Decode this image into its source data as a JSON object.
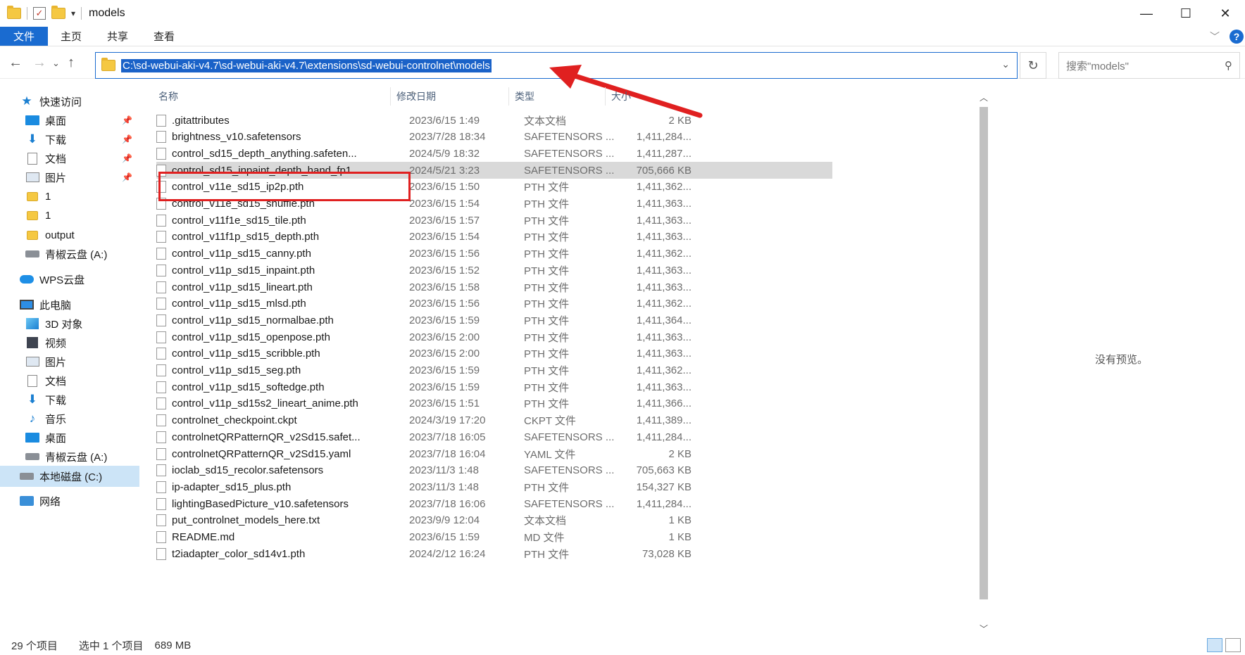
{
  "window": {
    "title": "models",
    "minimize": "—",
    "maximize": "☐",
    "close": "✕"
  },
  "ribbon": {
    "tabs": [
      "文件",
      "主页",
      "共享",
      "查看"
    ]
  },
  "address": {
    "path": "C:\\sd-webui-aki-v4.7\\sd-webui-aki-v4.7\\extensions\\sd-webui-controlnet\\models",
    "search_placeholder": "搜索\"models\""
  },
  "sidebar": {
    "items": [
      {
        "label": "快速访问",
        "icon": "star-icon"
      },
      {
        "label": "桌面",
        "icon": "desktop-icon"
      },
      {
        "label": "下载",
        "icon": "download-icon"
      },
      {
        "label": "文档",
        "icon": "document-icon"
      },
      {
        "label": "图片",
        "icon": "pictures-icon"
      },
      {
        "label": "1",
        "icon": "folder-icon"
      },
      {
        "label": "1",
        "icon": "folder-icon"
      },
      {
        "label": "output",
        "icon": "folder-icon"
      },
      {
        "label": "青椒云盘 (A:)",
        "icon": "drive-icon"
      },
      {
        "label": "WPS云盘",
        "icon": "cloud-icon"
      },
      {
        "label": "此电脑",
        "icon": "pc-icon"
      },
      {
        "label": "3D 对象",
        "icon": "3d-icon"
      },
      {
        "label": "视频",
        "icon": "video-icon"
      },
      {
        "label": "图片",
        "icon": "pictures-icon"
      },
      {
        "label": "文档",
        "icon": "document-icon"
      },
      {
        "label": "下载",
        "icon": "download-icon"
      },
      {
        "label": "音乐",
        "icon": "music-icon"
      },
      {
        "label": "桌面",
        "icon": "desktop-icon"
      },
      {
        "label": "青椒云盘 (A:)",
        "icon": "drive-icon"
      },
      {
        "label": "本地磁盘 (C:)",
        "icon": "drive-icon"
      },
      {
        "label": "网络",
        "icon": "network-icon"
      }
    ]
  },
  "columns": {
    "name": "名称",
    "date": "修改日期",
    "type": "类型",
    "size": "大小"
  },
  "files": [
    {
      "name": ".gitattributes",
      "date": "2023/6/15 1:49",
      "type": "文本文档",
      "size": "2 KB"
    },
    {
      "name": "brightness_v10.safetensors",
      "date": "2023/7/28 18:34",
      "type": "SAFETENSORS ...",
      "size": "1,411,284..."
    },
    {
      "name": "control_sd15_depth_anything.safeten...",
      "date": "2024/5/9 18:32",
      "type": "SAFETENSORS ...",
      "size": "1,411,287..."
    },
    {
      "name": "control_sd15_inpaint_depth_hand_fp1...",
      "date": "2024/5/21 3:23",
      "type": "SAFETENSORS ...",
      "size": "705,666 KB"
    },
    {
      "name": "control_v11e_sd15_ip2p.pth",
      "date": "2023/6/15 1:50",
      "type": "PTH 文件",
      "size": "1,411,362..."
    },
    {
      "name": "control_v11e_sd15_shuffle.pth",
      "date": "2023/6/15 1:54",
      "type": "PTH 文件",
      "size": "1,411,363..."
    },
    {
      "name": "control_v11f1e_sd15_tile.pth",
      "date": "2023/6/15 1:57",
      "type": "PTH 文件",
      "size": "1,411,363..."
    },
    {
      "name": "control_v11f1p_sd15_depth.pth",
      "date": "2023/6/15 1:54",
      "type": "PTH 文件",
      "size": "1,411,363..."
    },
    {
      "name": "control_v11p_sd15_canny.pth",
      "date": "2023/6/15 1:56",
      "type": "PTH 文件",
      "size": "1,411,362..."
    },
    {
      "name": "control_v11p_sd15_inpaint.pth",
      "date": "2023/6/15 1:52",
      "type": "PTH 文件",
      "size": "1,411,363..."
    },
    {
      "name": "control_v11p_sd15_lineart.pth",
      "date": "2023/6/15 1:58",
      "type": "PTH 文件",
      "size": "1,411,363..."
    },
    {
      "name": "control_v11p_sd15_mlsd.pth",
      "date": "2023/6/15 1:56",
      "type": "PTH 文件",
      "size": "1,411,362..."
    },
    {
      "name": "control_v11p_sd15_normalbae.pth",
      "date": "2023/6/15 1:59",
      "type": "PTH 文件",
      "size": "1,411,364..."
    },
    {
      "name": "control_v11p_sd15_openpose.pth",
      "date": "2023/6/15 2:00",
      "type": "PTH 文件",
      "size": "1,411,363..."
    },
    {
      "name": "control_v11p_sd15_scribble.pth",
      "date": "2023/6/15 2:00",
      "type": "PTH 文件",
      "size": "1,411,363..."
    },
    {
      "name": "control_v11p_sd15_seg.pth",
      "date": "2023/6/15 1:59",
      "type": "PTH 文件",
      "size": "1,411,362..."
    },
    {
      "name": "control_v11p_sd15_softedge.pth",
      "date": "2023/6/15 1:59",
      "type": "PTH 文件",
      "size": "1,411,363..."
    },
    {
      "name": "control_v11p_sd15s2_lineart_anime.pth",
      "date": "2023/6/15 1:51",
      "type": "PTH 文件",
      "size": "1,411,366..."
    },
    {
      "name": "controlnet_checkpoint.ckpt",
      "date": "2024/3/19 17:20",
      "type": "CKPT 文件",
      "size": "1,411,389..."
    },
    {
      "name": "controlnetQRPatternQR_v2Sd15.safet...",
      "date": "2023/7/18 16:05",
      "type": "SAFETENSORS ...",
      "size": "1,411,284..."
    },
    {
      "name": "controlnetQRPatternQR_v2Sd15.yaml",
      "date": "2023/7/18 16:04",
      "type": "YAML 文件",
      "size": "2 KB"
    },
    {
      "name": "ioclab_sd15_recolor.safetensors",
      "date": "2023/11/3 1:48",
      "type": "SAFETENSORS ...",
      "size": "705,663 KB"
    },
    {
      "name": "ip-adapter_sd15_plus.pth",
      "date": "2023/11/3 1:48",
      "type": "PTH 文件",
      "size": "154,327 KB"
    },
    {
      "name": "lightingBasedPicture_v10.safetensors",
      "date": "2023/7/18 16:06",
      "type": "SAFETENSORS ...",
      "size": "1,411,284..."
    },
    {
      "name": "put_controlnet_models_here.txt",
      "date": "2023/9/9 12:04",
      "type": "文本文档",
      "size": "1 KB"
    },
    {
      "name": "README.md",
      "date": "2023/6/15 1:59",
      "type": "MD 文件",
      "size": "1 KB"
    },
    {
      "name": "t2iadapter_color_sd14v1.pth",
      "date": "2024/2/12 16:24",
      "type": "PTH 文件",
      "size": "73,028 KB"
    }
  ],
  "selected_index": 3,
  "preview": {
    "text": "没有预览。"
  },
  "status": {
    "count": "29 个项目",
    "selected": "选中 1 个项目",
    "size": "689 MB"
  },
  "colors": {
    "accent": "#1a6bd0",
    "annotation": "#e02020"
  }
}
